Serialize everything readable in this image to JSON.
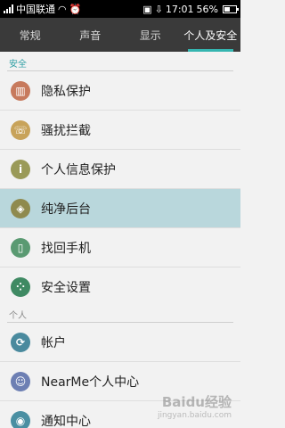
{
  "status_bar": {
    "carrier": "中国联通",
    "time": "17:01",
    "battery": "56%"
  },
  "tabs": [
    {
      "label": "常规"
    },
    {
      "label": "声音"
    },
    {
      "label": "显示"
    },
    {
      "label": "个人及安全",
      "active": true
    }
  ],
  "sections": {
    "security": "安全",
    "personal": "个人"
  },
  "items": [
    {
      "label": "隐私保护",
      "icon": "privacy-icon",
      "color": "#c77a5d"
    },
    {
      "label": "骚扰拦截",
      "icon": "phone-block-icon",
      "color": "#c8a35a"
    },
    {
      "label": "个人信息保护",
      "icon": "info-lock-icon",
      "color": "#9a9a58"
    },
    {
      "label": "纯净后台",
      "icon": "shield-icon",
      "color": "#8f8a4e",
      "selected": true
    },
    {
      "label": "找回手机",
      "icon": "find-phone-icon",
      "color": "#5a9a72"
    },
    {
      "label": "安全设置",
      "icon": "keypad-icon",
      "color": "#3f8a63"
    },
    {
      "label": "帐户",
      "icon": "account-sync-icon",
      "color": "#4a8a9e"
    },
    {
      "label": "NearMe个人中心",
      "icon": "nearme-user-icon",
      "color": "#6d7fb3"
    },
    {
      "label": "通知中心",
      "icon": "notification-icon",
      "color": "#4a8fa2"
    }
  ],
  "watermark": {
    "brand": "Baidu经验",
    "url": "jingyan.baidu.com"
  }
}
